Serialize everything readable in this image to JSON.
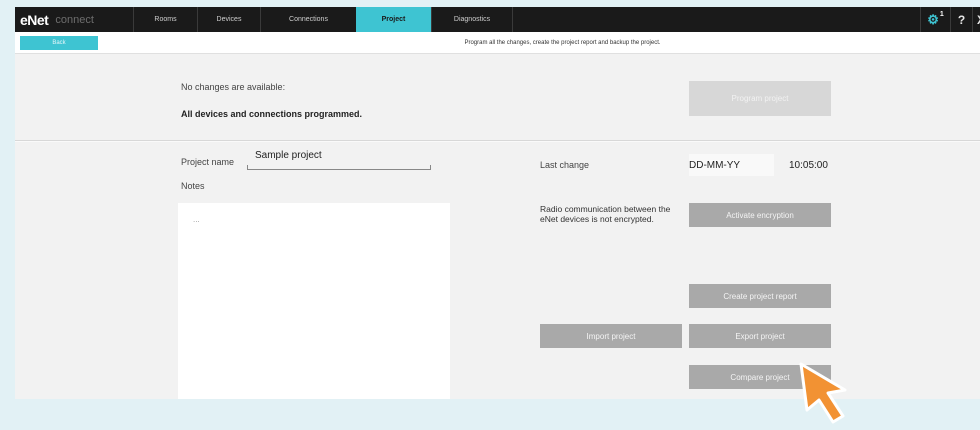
{
  "app": {
    "logo_main": "eNet",
    "logo_sub": "connect"
  },
  "nav": {
    "tabs": [
      {
        "label": "Rooms"
      },
      {
        "label": "Devices"
      },
      {
        "label": "Connections"
      },
      {
        "label": "Project",
        "active": true
      },
      {
        "label": "Diagnostics"
      }
    ],
    "settings_badge": "1",
    "help_label": "?",
    "close_label": "X"
  },
  "subbar": {
    "back_label": "Back",
    "hint": "Program all the changes, create the project report and backup the project."
  },
  "changes": {
    "title": "No changes are available:",
    "status": "All devices and connections programmed.",
    "program_button": "Program project"
  },
  "project": {
    "name_label": "Project name",
    "name_value": "Sample project",
    "notes_label": "Notes",
    "notes_value": "...",
    "last_change_label": "Last change",
    "last_change_date": "DD-MM-YY",
    "last_change_time": "10:05:00",
    "radio_info": "Radio communication between the eNet devices is not encrypted.",
    "activate_encryption": "Activate encryption",
    "create_report": "Create project report",
    "import_project": "Import project",
    "export_project": "Export project",
    "compare_project": "Compare project"
  },
  "colors": {
    "accent": "#3ec4d2",
    "nav_bg": "#1a1a1a",
    "button": "#a9a9a9",
    "button_disabled": "#d7d7d7",
    "cursor": "#f29233"
  }
}
